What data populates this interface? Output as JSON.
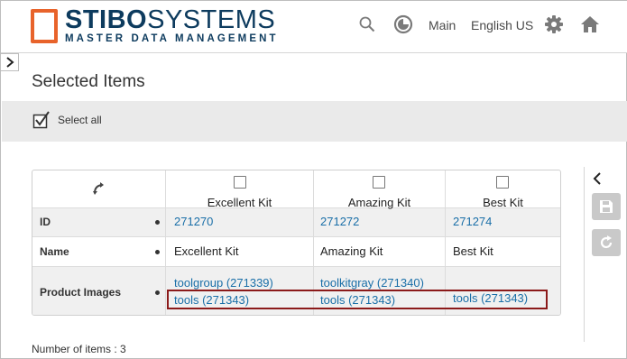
{
  "header": {
    "logo_title_bold": "STIBO",
    "logo_title_light": "SYSTEMS",
    "logo_subtitle": "MASTER DATA MANAGEMENT",
    "workspace": "Main",
    "locale": "English US"
  },
  "page": {
    "title": "Selected Items",
    "select_all": "Select all",
    "item_count": "Number of items : 3"
  },
  "table": {
    "columns": [
      {
        "name": "Excellent Kit",
        "id": "271270"
      },
      {
        "name": "Amazing Kit",
        "id": "271272"
      },
      {
        "name": "Best Kit",
        "id": "271274"
      }
    ],
    "row_labels": {
      "id": "ID",
      "name": "Name",
      "images": "Product Images"
    },
    "names": [
      "Excellent Kit",
      "Amazing Kit",
      "Best Kit"
    ],
    "images_row1": [
      "toolgroup (271339)",
      "toolkitgray (271340)",
      ""
    ],
    "images_row2": [
      "tools (271343)",
      "tools (271343)",
      "tools (271343)"
    ]
  },
  "colors": {
    "brand_orange": "#e8632b",
    "brand_navy": "#0d3b5e",
    "link": "#1a6fa8",
    "highlight": "#8b1a1a"
  }
}
